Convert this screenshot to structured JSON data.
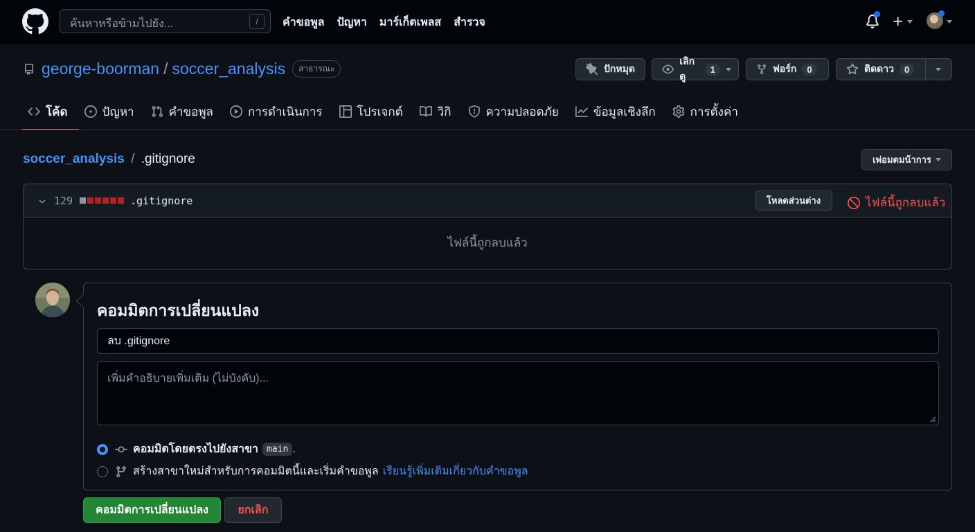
{
  "header": {
    "search_placeholder": "ค้นหาหรือข้ามไปยัง...",
    "search_shortcut": "/",
    "nav": [
      "คำขอพูล",
      "ปัญหา",
      "มาร์เก็ตเพลส",
      "สำรวจ"
    ]
  },
  "repo": {
    "owner": "george-boorman",
    "separator": "/",
    "name": "soccer_analysis",
    "visibility": "สาธารณะ",
    "pin_label": "ปักหมุด",
    "watch_label": "เลิกดู",
    "watch_count": "1",
    "fork_label": "ฟอร์ก",
    "fork_count": "0",
    "star_label": "ติดดาว",
    "star_count": "0"
  },
  "tabs": [
    "โค้ด",
    "ปัญหา",
    "คำขอพูล",
    "การดำเนินการ",
    "โปรเจกต์",
    "วิกิ",
    "ความปลอดภัย",
    "ข้อมูลเชิงลึก",
    "การตั้งค่า"
  ],
  "breadcrumb": {
    "repo": "soccer_analysis",
    "separator": "/",
    "file": ".gitignore"
  },
  "options_label": "เพ่อมตมน้าการ",
  "file": {
    "line_count": "129",
    "name": ".gitignore",
    "load_diff_label": "โหลดส่วนต่าง",
    "deleted_badge": "ไฟล์นี้ถูกลบแล้ว",
    "body_text": "ไฟล์นี้ถูกลบแล้ว"
  },
  "commit": {
    "title": "คอมมิตการเปลี่ยนแปลง",
    "message_value": "ลบ .gitignore",
    "description_placeholder": "เพิ่มคำอธิบายเพิ่มเติม (ไม่บังคับ)...",
    "option_direct_label": "คอมมิตโดยตรงไปยังสาขา",
    "branch": "main",
    "option_direct_suffix": ".",
    "option_new_branch_label": "สร้างสาขาใหม่สำหรับการคอมมิตนี้และเริ่มคำขอพูล",
    "learn_more_link": "เรียนรู้เพิ่มเติมเกี่ยวกับคำขอพูล",
    "submit_label": "คอมมิตการเปลี่ยนแปลง",
    "cancel_label": "ยกเลิก"
  },
  "colors": {
    "background": "#0d1117",
    "header_bg": "#010409",
    "link": "#4493f8",
    "danger": "#f85149",
    "primary_button": "#238636",
    "active_tab_underline": "#f78166"
  },
  "icons": [
    "github-logo-icon",
    "bell-icon",
    "plus-icon",
    "repo-icon",
    "pin-icon",
    "eye-icon",
    "fork-icon",
    "star-icon",
    "code-icon",
    "issue-icon",
    "pull-request-icon",
    "play-icon",
    "table-icon",
    "book-icon",
    "shield-icon",
    "graph-icon",
    "gear-icon",
    "chevron-down-icon",
    "no-entry-icon",
    "commit-icon",
    "branch-icon"
  ]
}
